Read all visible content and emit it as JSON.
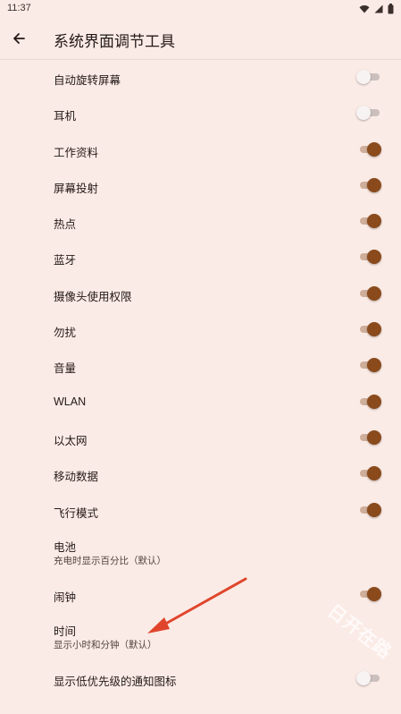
{
  "status_bar": {
    "time": "11:37"
  },
  "app_bar": {
    "title": "系统界面调节工具"
  },
  "items": [
    {
      "label": "自动旋转屏幕",
      "toggle": "off"
    },
    {
      "label": "耳机",
      "toggle": "off"
    },
    {
      "label": "工作资料",
      "toggle": "on"
    },
    {
      "label": "屏幕投射",
      "toggle": "on"
    },
    {
      "label": "热点",
      "toggle": "on"
    },
    {
      "label": "蓝牙",
      "toggle": "on"
    },
    {
      "label": "摄像头使用权限",
      "toggle": "on"
    },
    {
      "label": "勿扰",
      "toggle": "on"
    },
    {
      "label": "音量",
      "toggle": "on"
    },
    {
      "label": "WLAN",
      "toggle": "on"
    },
    {
      "label": "以太网",
      "toggle": "on"
    },
    {
      "label": "移动数据",
      "toggle": "on"
    },
    {
      "label": "飞行模式",
      "toggle": "on"
    },
    {
      "label": "电池",
      "subtitle": "充电时显示百分比（默认）",
      "toggle": "none"
    },
    {
      "label": "闹钟",
      "toggle": "on"
    },
    {
      "label": "时间",
      "subtitle": "显示小时和分钟（默认）",
      "toggle": "none"
    },
    {
      "label": "显示低优先级的通知图标",
      "toggle": "off"
    }
  ],
  "watermark": "日开在路",
  "colors": {
    "accent": "#8a4a1c",
    "background": "#fbebe6",
    "annotation_arrow": "#e0452b"
  }
}
